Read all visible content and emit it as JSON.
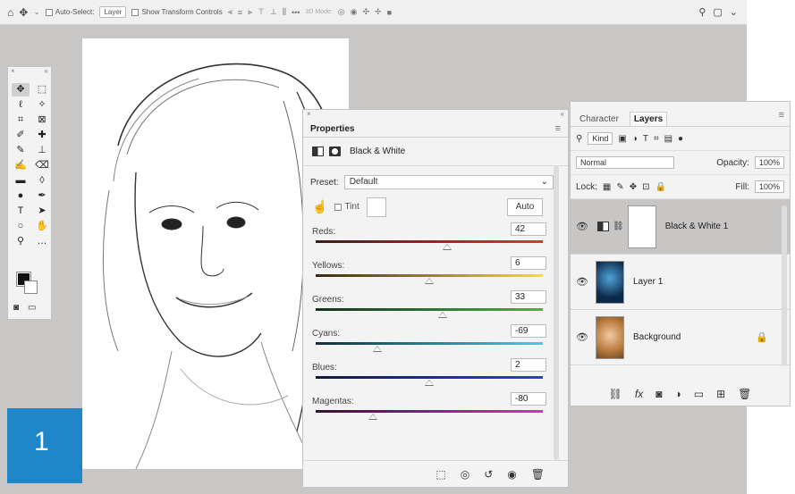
{
  "options_bar": {
    "auto_select_label": "Auto-Select:",
    "auto_select_target": "Layer",
    "show_transform_label": "Show Transform Controls",
    "mode_label": "3D Mode:"
  },
  "badge": {
    "number": "1"
  },
  "properties_panel": {
    "title": "Properties",
    "adjustment_name": "Black & White",
    "preset_label": "Preset:",
    "preset_value": "Default",
    "tint_label": "Tint",
    "auto_label": "Auto",
    "sliders": [
      {
        "name": "Reds:",
        "value": "42",
        "pos": 0.58,
        "gradient": "linear-gradient(90deg,#3b1c1c,#e3342f)"
      },
      {
        "name": "Yellows:",
        "value": "6",
        "pos": 0.5,
        "gradient": "linear-gradient(90deg,#3b2a12,#f4e02c)"
      },
      {
        "name": "Greens:",
        "value": "33",
        "pos": 0.56,
        "gradient": "linear-gradient(90deg,#14301c,#49b34a)"
      },
      {
        "name": "Cyans:",
        "value": "-69",
        "pos": 0.27,
        "gradient": "linear-gradient(90deg,#10303a,#3fd1e6)"
      },
      {
        "name": "Blues:",
        "value": "2",
        "pos": 0.5,
        "gradient": "linear-gradient(90deg,#12183d,#2a3fd6)"
      },
      {
        "name": "Magentas:",
        "value": "-80",
        "pos": 0.25,
        "gradient": "linear-gradient(90deg,#34102f,#d92fc9)"
      }
    ]
  },
  "layers_panel": {
    "tabs": [
      "Character",
      "Layers"
    ],
    "kind_label": "Kind",
    "blend_mode": "Normal",
    "opacity_label": "Opacity:",
    "opacity_value": "100%",
    "lock_label": "Lock:",
    "fill_label": "Fill:",
    "fill_value": "100%",
    "layers": [
      {
        "name": "Black & White 1"
      },
      {
        "name": "Layer 1"
      },
      {
        "name": "Background"
      }
    ]
  }
}
